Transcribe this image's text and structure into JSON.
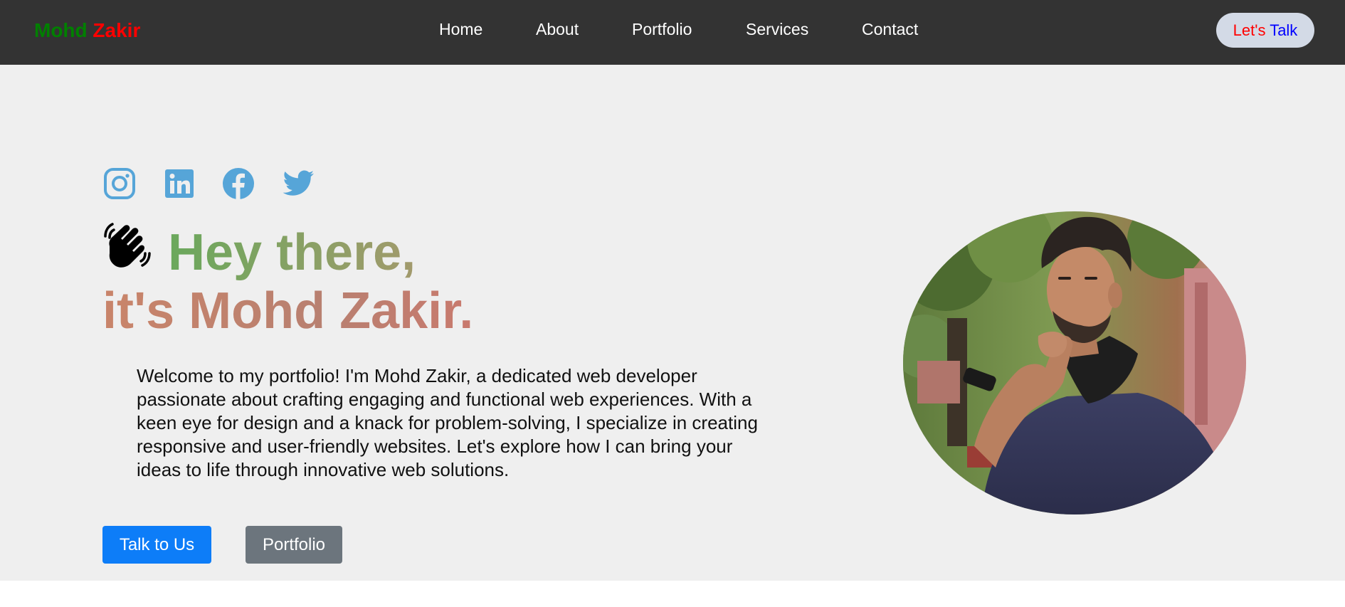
{
  "nav": {
    "brand_first": "Mohd",
    "brand_last": "Zakir",
    "links": [
      "Home",
      "About",
      "Portfolio",
      "Services",
      "Contact"
    ],
    "cta_part1": "Let's",
    "cta_part2": "Talk"
  },
  "hero": {
    "social_icons": [
      "instagram-icon",
      "linkedin-icon",
      "facebook-icon",
      "twitter-icon"
    ],
    "greeting": "Hey there,",
    "name_line": "it's Mohd Zakir.",
    "intro": "Welcome to my portfolio! I'm Mohd Zakir, a dedicated web developer passionate about crafting engaging and functional web experiences. With a keen eye for design and a knack for problem-solving, I specialize in creating responsive and user-friendly websites. Let's explore how I can bring your ideas to life through innovative web solutions.",
    "primary_button": "Talk to Us",
    "secondary_button": "Portfolio",
    "photo_icon": "profile-photo"
  },
  "colors": {
    "navbar": "#333333",
    "hero_bg": "#efefef",
    "social_icon": "#56a5d8",
    "primary": "#0d7df8",
    "secondary": "#6c757d"
  }
}
